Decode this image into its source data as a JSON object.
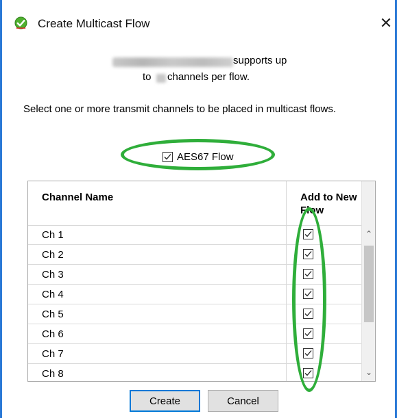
{
  "window": {
    "title": "Create Multicast Flow",
    "close_glyph": "✕",
    "icon": "green-check-circle-icon"
  },
  "header": {
    "supports_text": "supports up",
    "to_text": "to",
    "channels_text": "channels per flow."
  },
  "instruction": "Select one or more transmit channels to be placed in multicast flows.",
  "aes67": {
    "label": "AES67 Flow",
    "checked": true
  },
  "table": {
    "columns": [
      "Channel Name",
      "Add to New Flow"
    ],
    "rows": [
      {
        "name": "Ch 1",
        "checked": true
      },
      {
        "name": "Ch 2",
        "checked": true
      },
      {
        "name": "Ch 3",
        "checked": true
      },
      {
        "name": "Ch 4",
        "checked": true
      },
      {
        "name": "Ch 5",
        "checked": true
      },
      {
        "name": "Ch 6",
        "checked": true
      },
      {
        "name": "Ch 7",
        "checked": true
      },
      {
        "name": "Ch 8",
        "checked": true
      }
    ]
  },
  "buttons": {
    "create": "Create",
    "cancel": "Cancel"
  },
  "colors": {
    "frame": "#2b79d6",
    "highlight_oval": "#2fae3a",
    "default_button_border": "#0078d7"
  }
}
